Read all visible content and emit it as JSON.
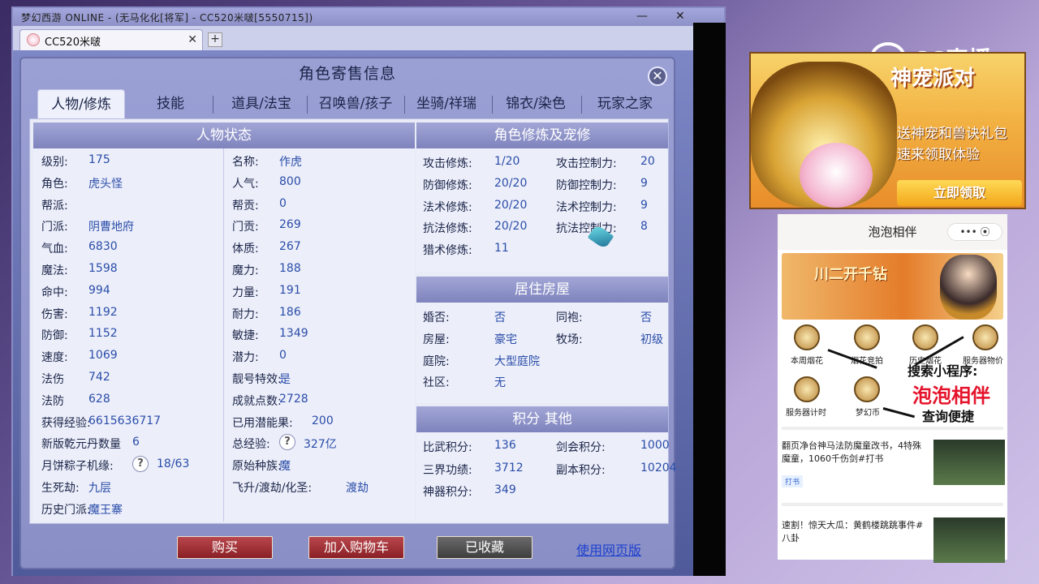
{
  "game_window": {
    "title": "梦幻西游 ONLINE - (无马化化[将军] - CC520米啵[5550715])",
    "browser_tab_label": "CC520米啵"
  },
  "dialog": {
    "title": "角色寄售信息",
    "tabs": [
      "人物/修炼",
      "技能",
      "道具/法宝",
      "召唤兽/孩子",
      "坐骑/祥瑞",
      "锦衣/染色",
      "玩家之家"
    ],
    "active_tab": "人物/修炼"
  },
  "character_status": {
    "header": "人物状态",
    "left": [
      {
        "label": "级别:",
        "value": "175"
      },
      {
        "label": "角色:",
        "value": "虎头怪"
      },
      {
        "label": "帮派:",
        "value": ""
      },
      {
        "label": "门派:",
        "value": "阴曹地府"
      },
      {
        "label": "气血:",
        "value": "6830"
      },
      {
        "label": "魔法:",
        "value": "1598"
      },
      {
        "label": "命中:",
        "value": "994"
      },
      {
        "label": "伤害:",
        "value": "1192"
      },
      {
        "label": "防御:",
        "value": "1152"
      },
      {
        "label": "速度:",
        "value": "1069"
      },
      {
        "label": "法伤",
        "value": "742"
      },
      {
        "label": "法防",
        "value": "628"
      },
      {
        "label": "获得经验:",
        "value": "6615636717"
      },
      {
        "label": "新版乾元丹数量",
        "value": "6"
      },
      {
        "label": "月饼粽子机缘:",
        "value": "18/63"
      },
      {
        "label": "生死劫:",
        "value": "九层"
      },
      {
        "label": "历史门派:",
        "value": "魔王寨"
      }
    ],
    "right": [
      {
        "label": "名称:",
        "value": "作虎"
      },
      {
        "label": "人气:",
        "value": "800"
      },
      {
        "label": "帮贡:",
        "value": "0"
      },
      {
        "label": "门贡:",
        "value": "269"
      },
      {
        "label": "体质:",
        "value": "267"
      },
      {
        "label": "魔力:",
        "value": "188"
      },
      {
        "label": "力量:",
        "value": "191"
      },
      {
        "label": "耐力:",
        "value": "186"
      },
      {
        "label": "敏捷:",
        "value": "1349"
      },
      {
        "label": "潜力:",
        "value": "0"
      },
      {
        "label": "靓号特效:",
        "value": "是"
      },
      {
        "label": "成就点数:",
        "value": "2728"
      },
      {
        "label": "已用潜能果:",
        "value": "200"
      },
      {
        "label": "总经验:",
        "value": "327亿"
      },
      {
        "label": "原始种族:",
        "value": "魔"
      },
      {
        "label": "飞升/渡劫/化圣:",
        "value": "渡劫"
      }
    ]
  },
  "cultivation": {
    "header": "角色修炼及宠修",
    "rows": [
      {
        "l1": "攻击修炼:",
        "v1": "1/20",
        "l2": "攻击控制力:",
        "v2": "20"
      },
      {
        "l1": "防御修炼:",
        "v1": "20/20",
        "l2": "防御控制力:",
        "v2": "9"
      },
      {
        "l1": "法术修炼:",
        "v1": "20/20",
        "l2": "法术控制力:",
        "v2": "9"
      },
      {
        "l1": "抗法修炼:",
        "v1": "20/20",
        "l2": "抗法控制力:",
        "v2": "8"
      },
      {
        "l1": "猎术修炼:",
        "v1": "11",
        "l2": "",
        "v2": ""
      }
    ]
  },
  "housing": {
    "header": "居住房屋",
    "rows": [
      {
        "l1": "婚否:",
        "v1": "否",
        "l2": "同袍:",
        "v2": "否"
      },
      {
        "l1": "房屋:",
        "v1": "豪宅",
        "l2": "牧场:",
        "v2": "初级"
      },
      {
        "l1": "庭院:",
        "v1": "大型庭院",
        "l2": "",
        "v2": ""
      },
      {
        "l1": "社区:",
        "v1": "无",
        "l2": "",
        "v2": ""
      }
    ]
  },
  "points": {
    "header": "积分 其他",
    "rows": [
      {
        "l1": "比武积分:",
        "v1": "136",
        "l2": "剑会积分:",
        "v2": "1000"
      },
      {
        "l1": "三界功绩:",
        "v1": "3712",
        "l2": "副本积分:",
        "v2": "10204"
      },
      {
        "l1": "神器积分:",
        "v1": "349",
        "l2": "",
        "v2": ""
      }
    ]
  },
  "buttons": {
    "buy": "购买",
    "add_cart": "加入购物车",
    "collected": "已收藏",
    "web_link": "使用网页版"
  },
  "sidebar": {
    "cc_logo": "CC直播",
    "ad": {
      "title": "神宠派对",
      "line1": "送神宠和兽诀礼包",
      "line2": "速来领取体验",
      "button": "立即领取"
    },
    "mini_app": {
      "title": "泡泡相伴",
      "menu": "•••  ⦿",
      "banner_text": "川二开千钻",
      "icons": [
        "本周烟花",
        "烟花竞拍",
        "历史烟花",
        "服务器物价",
        "服务器计时",
        "梦幻币"
      ],
      "promo_line1": "搜索小程序:",
      "promo_line2": "泡泡相伴",
      "promo_line3": "查询便捷",
      "news1": "翻页净台神马法防魔童改书，4特殊魔童，1060千伤剑#打书",
      "news1_tag": "打书",
      "news2": "速割！惊天大瓜：黄鹤楼跳跳事件#八卦"
    }
  }
}
